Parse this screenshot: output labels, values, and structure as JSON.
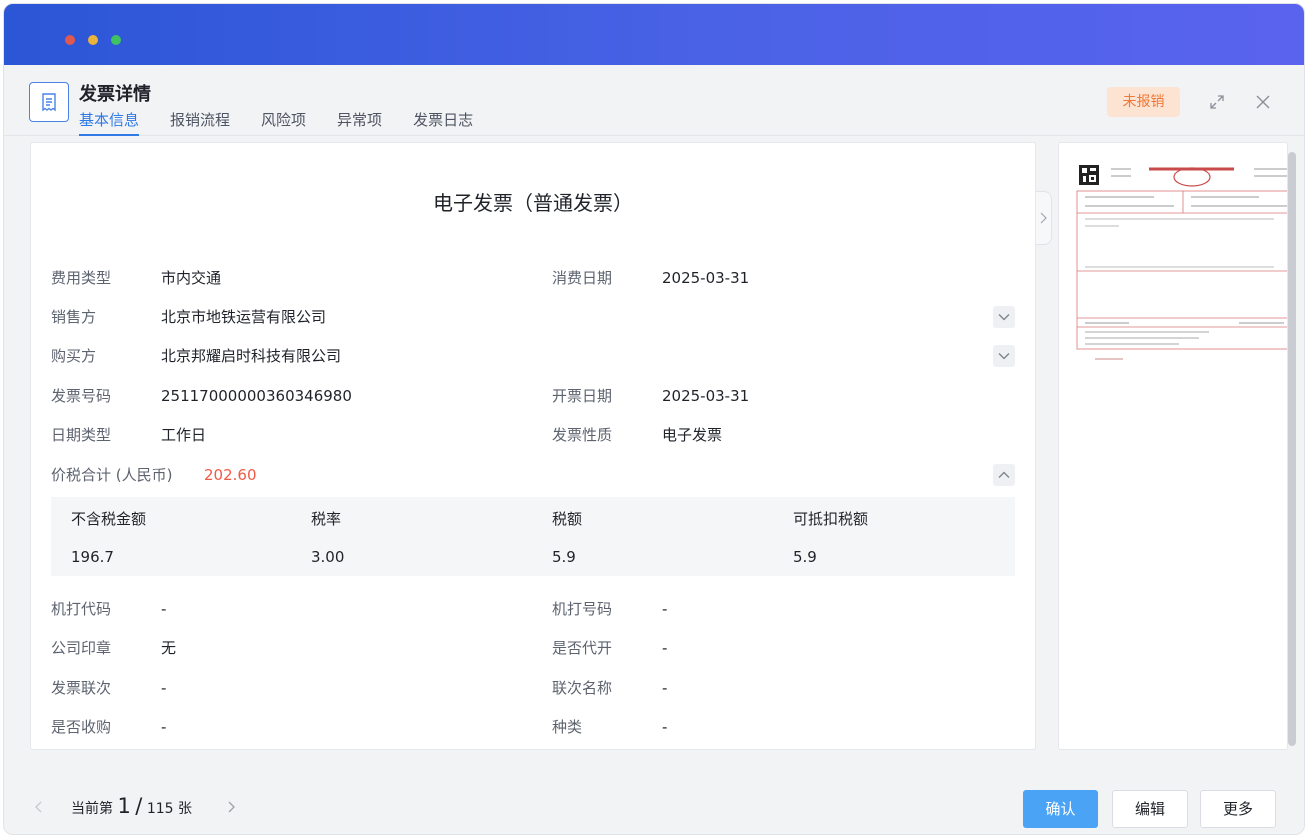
{
  "header": {
    "title": "发票详情",
    "tabs": [
      {
        "label": "基本信息"
      },
      {
        "label": "报销流程"
      },
      {
        "label": "风险项"
      },
      {
        "label": "异常项"
      },
      {
        "label": "发票日志"
      }
    ],
    "active_tab": "基本信息",
    "status_badge": "未报销"
  },
  "invoice": {
    "title": "电子发票（普通发票）",
    "expense_type_label": "费用类型",
    "expense_type": "市内交通",
    "consume_date_label": "消费日期",
    "consume_date": "2025-03-31",
    "seller_label": "销售方",
    "seller": "北京市地铁运营有限公司",
    "buyer_label": "购买方",
    "buyer": "北京邦耀启时科技有限公司",
    "invoice_no_label": "发票号码",
    "invoice_no": "25117000000360346980",
    "issue_date_label": "开票日期",
    "issue_date": "2025-03-31",
    "date_type_label": "日期类型",
    "date_type": "工作日",
    "nature_label": "发票性质",
    "nature": "电子发票",
    "total_label": "价税合计 (人民币)",
    "total": "202.60"
  },
  "tax_table": {
    "headers": [
      "不含税金额",
      "税率",
      "税额",
      "可抵扣税额"
    ],
    "values": [
      "196.7",
      "3.00",
      "5.9",
      "5.9"
    ]
  },
  "extra": {
    "machine_code_label": "机打代码",
    "machine_code": "-",
    "machine_no_label": "机打号码",
    "machine_no": "-",
    "seal_label": "公司印章",
    "seal": "无",
    "proxy_label": "是否代开",
    "proxy": "-",
    "copy_label": "发票联次",
    "copy": "-",
    "copy_name_label": "联次名称",
    "copy_name": "-",
    "purchase_label": "是否收购",
    "purchase": "-",
    "kind_label": "种类",
    "kind": "-"
  },
  "pager": {
    "prefix": "当前第",
    "current": "1",
    "sep": "/",
    "total": "115 张"
  },
  "buttons": {
    "confirm": "确认",
    "edit": "编辑",
    "more": "更多"
  },
  "colors": {
    "accent": "#2f7ae5",
    "primary_button": "#4aa3f5",
    "amount": "#f05a46",
    "badge_bg": "#fde3d2",
    "badge_text": "#f07836"
  },
  "icons": [
    "receipt-icon",
    "expand-icon",
    "close-icon",
    "chevron-down-icon",
    "chevron-up-icon",
    "chevron-right-icon",
    "chevron-left-icon"
  ]
}
